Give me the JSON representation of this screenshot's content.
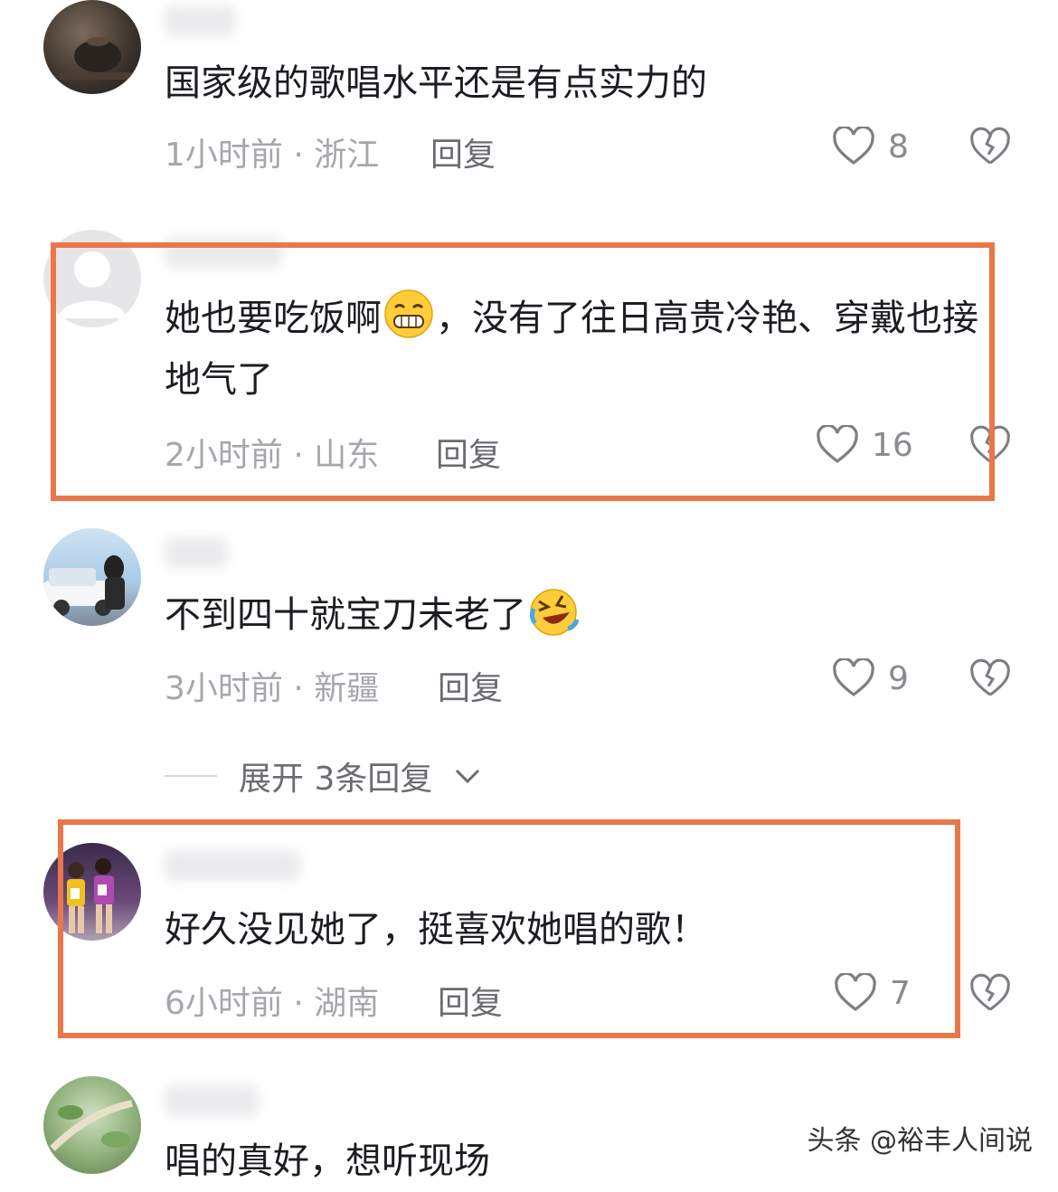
{
  "comments": [
    {
      "text": "国家级的歌唱水平还是有点实力的",
      "meta": "1小时前 · 浙江",
      "reply": "回复",
      "likes": "8",
      "avatar_icon": "teapot-avatar"
    },
    {
      "text_a": "她也要吃饭啊",
      "text_b": "，没有了往日高贵冷艳、穿戴也接地气了",
      "meta": "2小时前 · 山东",
      "reply": "回复",
      "likes": "16",
      "avatar_icon": "default-avatar"
    },
    {
      "text": "不到四十就宝刀未老了",
      "meta": "3小时前 · 新疆",
      "reply": "回复",
      "likes": "9",
      "avatar_icon": "car-photo-avatar"
    },
    {
      "text": "好久没见她了，挺喜欢她唱的歌！",
      "meta": "6小时前 · 湖南",
      "reply": "回复",
      "likes": "7",
      "avatar_icon": "athletes-photo-avatar"
    },
    {
      "text": "唱的真好，想听现场",
      "avatar_icon": "plant-photo-avatar"
    }
  ],
  "expand_replies": "展开 3条回复",
  "watermark": "头条 @裕丰人间说",
  "colors": {
    "highlight": "#e9774a",
    "meta": "#a6a6ad",
    "text": "#1c1c22"
  }
}
